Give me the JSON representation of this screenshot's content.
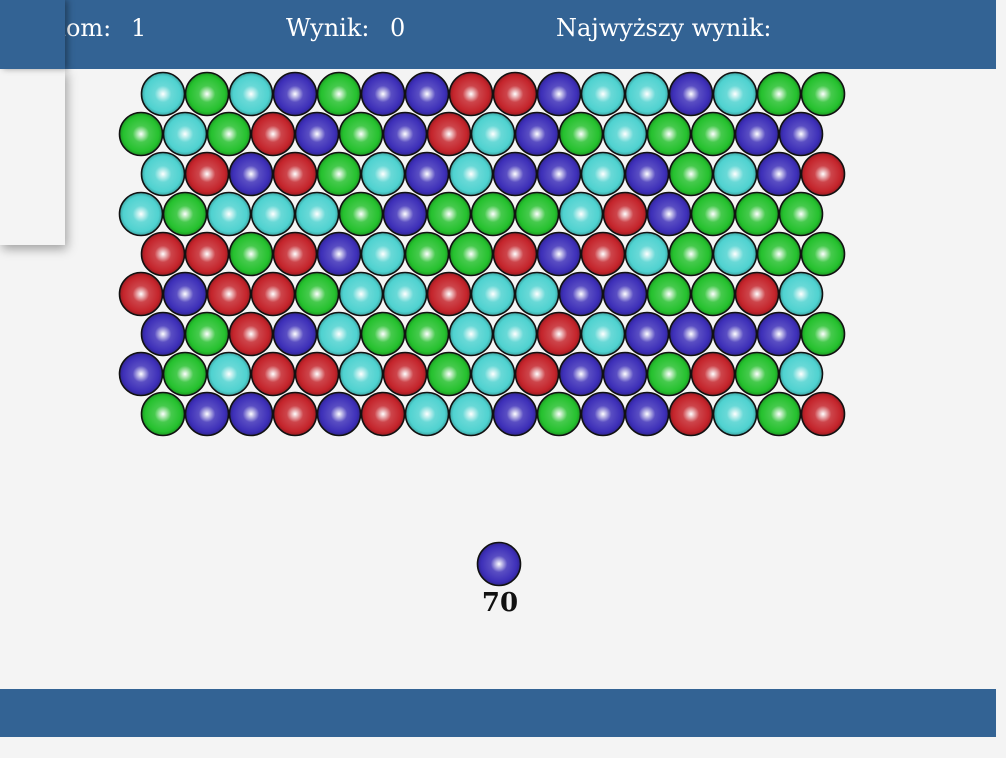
{
  "header": {
    "level_label": "Poziom:",
    "level_value": "1",
    "score_label": "Wynik:",
    "score_value": "0",
    "highscore_label": "Najwyższy wynik:",
    "highscore_value": ""
  },
  "colors": {
    "header_bg": "#336394",
    "background": "#f4f4f4",
    "C": "#4fd2d0",
    "G": "#25c12e",
    "B": "#3d2fb8",
    "R": "#c4242b"
  },
  "bubble_legend": {
    "C": "cyan",
    "G": "green",
    "B": "blue",
    "R": "red"
  },
  "grid": [
    "CGCBGBBRRBCCBCGG",
    "GCGRBGBRCBGCGGBB",
    "CRBRGCBCBBCBGCBR",
    "CGCCCGBGGGCRBGGG",
    "RRGRBCGGRBRCGCGG",
    "RBRRGCCRCCBBGGRC",
    "BGRBCGGCCRCBBBBG",
    "BGCRRCRGCRBBGRGC",
    "GBBRBRCCBGBBRCGR"
  ],
  "shooter": {
    "color": "B",
    "shots_left": "70"
  }
}
